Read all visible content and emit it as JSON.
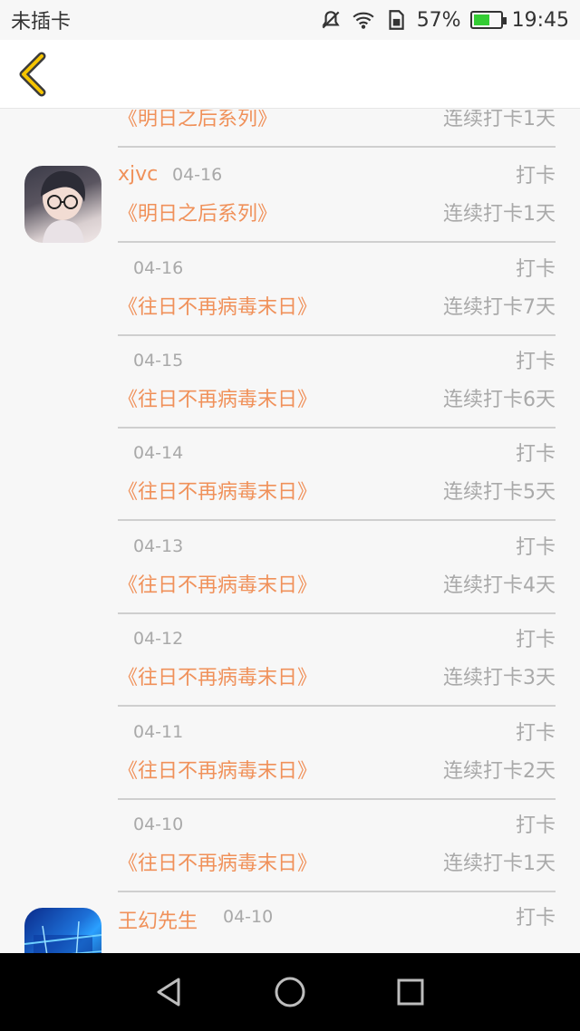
{
  "status_bar": {
    "carrier": "未插卡",
    "battery_percent": "57%",
    "time": "19:45",
    "icons": [
      "mute-icon",
      "wifi-icon",
      "sim-icon",
      "battery-icon"
    ]
  },
  "toolbar": {
    "back_icon": "chevron-left-icon",
    "accent_color": "#f5c400"
  },
  "colors": {
    "orange": "#f0915a",
    "gray_text": "#a9a9a9"
  },
  "checkins": [
    {
      "user": "",
      "date": "",
      "action": "",
      "book": "《明日之后系列》",
      "streak": "连续打卡1天"
    },
    {
      "user": "xjvc",
      "date": "04-16",
      "action": "打卡",
      "book": "《明日之后系列》",
      "streak": "连续打卡1天"
    },
    {
      "user": "",
      "date": "04-16",
      "action": "打卡",
      "book": "《往日不再病毒末日》",
      "streak": "连续打卡7天"
    },
    {
      "user": "",
      "date": "04-15",
      "action": "打卡",
      "book": "《往日不再病毒末日》",
      "streak": "连续打卡6天"
    },
    {
      "user": "",
      "date": "04-14",
      "action": "打卡",
      "book": "《往日不再病毒末日》",
      "streak": "连续打卡5天"
    },
    {
      "user": "",
      "date": "04-13",
      "action": "打卡",
      "book": "《往日不再病毒末日》",
      "streak": "连续打卡4天"
    },
    {
      "user": "",
      "date": "04-12",
      "action": "打卡",
      "book": "《往日不再病毒末日》",
      "streak": "连续打卡3天"
    },
    {
      "user": "",
      "date": "04-11",
      "action": "打卡",
      "book": "《往日不再病毒末日》",
      "streak": "连续打卡2天"
    },
    {
      "user": "",
      "date": "04-10",
      "action": "打卡",
      "book": "《往日不再病毒末日》",
      "streak": "连续打卡1天"
    },
    {
      "user": "王幻先生",
      "date": "04-10",
      "action": "打卡",
      "book": "",
      "streak": ""
    }
  ],
  "nav_bar": {
    "icons": [
      "back-triangle-icon",
      "home-circle-icon",
      "recents-square-icon"
    ]
  }
}
